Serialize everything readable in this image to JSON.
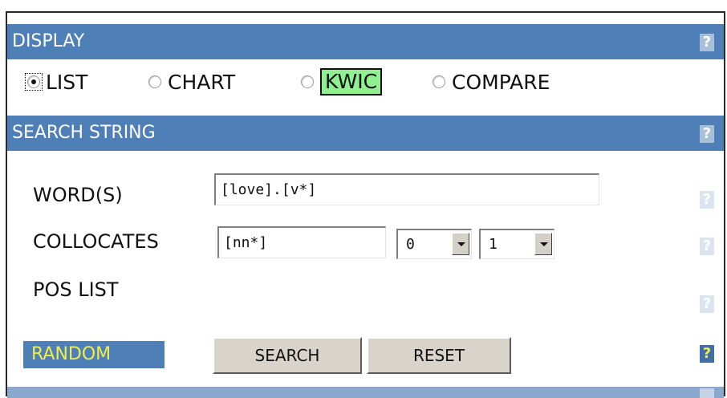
{
  "display": {
    "header": "DISPLAY",
    "help": "?",
    "options": [
      {
        "label": "LIST",
        "checked": true
      },
      {
        "label": "CHART",
        "checked": false
      },
      {
        "label": "KWIC",
        "checked": false,
        "highlight": "#8ef08e"
      },
      {
        "label": "COMPARE",
        "checked": false
      }
    ]
  },
  "search_string": {
    "header": "SEARCH STRING",
    "help": "?",
    "words_label": "WORD(S)",
    "words_value": "[love].[v*]",
    "collocates_label": "COLLOCATES",
    "collocates_value": "[nn*]",
    "collocates_left_span": "0",
    "collocates_right_span": "1",
    "pos_list_label": "POS LIST",
    "row_help": "?"
  },
  "actions": {
    "random_label": "RANDOM",
    "search_label": "SEARCH",
    "reset_label": "RESET",
    "help": "?"
  },
  "colors": {
    "header_bg": "#4e7fb6",
    "random_text": "#f1ee4a",
    "kwic_highlight": "#8ef08e"
  }
}
